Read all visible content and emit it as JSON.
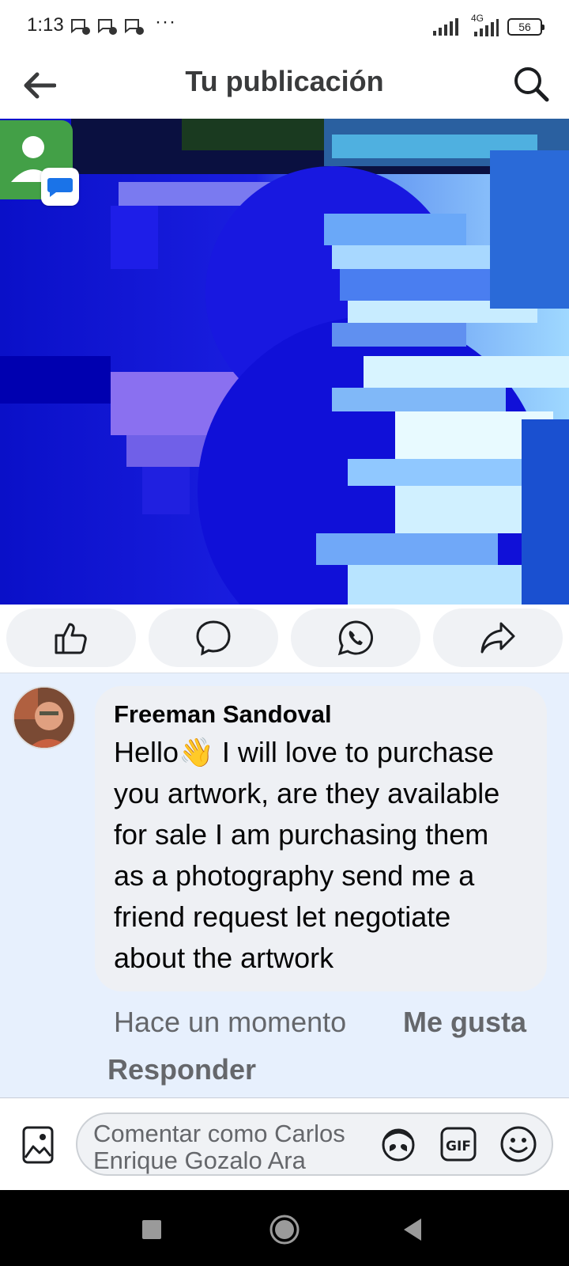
{
  "status_bar": {
    "time": "1:13",
    "overflow": "···",
    "network": "4G",
    "battery": "56",
    "icons": [
      "message-notification-icon",
      "message-notification-icon",
      "message-notification-icon",
      "signal-icon",
      "signal-4g-icon",
      "battery-icon"
    ]
  },
  "header": {
    "title": "Tu publicación",
    "back_icon": "arrow-left-icon",
    "search_icon": "search-icon"
  },
  "post": {
    "image": "glitch-artwork-blue",
    "overlay_icons": [
      "contact-icon",
      "messages-app-icon"
    ]
  },
  "actions": [
    {
      "name": "like",
      "icon": "thumbs-up-icon"
    },
    {
      "name": "comment",
      "icon": "comment-bubble-icon"
    },
    {
      "name": "whatsapp",
      "icon": "whatsapp-icon"
    },
    {
      "name": "share",
      "icon": "share-arrow-icon"
    }
  ],
  "comment": {
    "author": "Freeman Sandoval",
    "lines": [
      "Hello👋 I will love to purchase",
      "you artwork, are they available",
      "for sale I am purchasing them",
      "as a photography send me a",
      "friend request let negotiate",
      "about the artwork"
    ],
    "time": "Hace un momento",
    "like_label": "Me gusta",
    "reply_label": "Responder"
  },
  "composer": {
    "placeholder_line1": "Comentar como Carlos",
    "placeholder_line2": "Enrique Gozalo Ara",
    "icons": [
      "photo-icon",
      "avatar-sticker-icon",
      "gif-icon",
      "emoji-icon"
    ],
    "gif_label": "GIF"
  },
  "navbar": {
    "icons": [
      "recents-square-icon",
      "home-circle-icon",
      "back-triangle-icon"
    ]
  },
  "colors": {
    "accent_blue": "#1877f2",
    "comment_bg": "#e7f0fd",
    "bubble_bg": "#eef0f4",
    "secondary_text": "#65676b"
  }
}
